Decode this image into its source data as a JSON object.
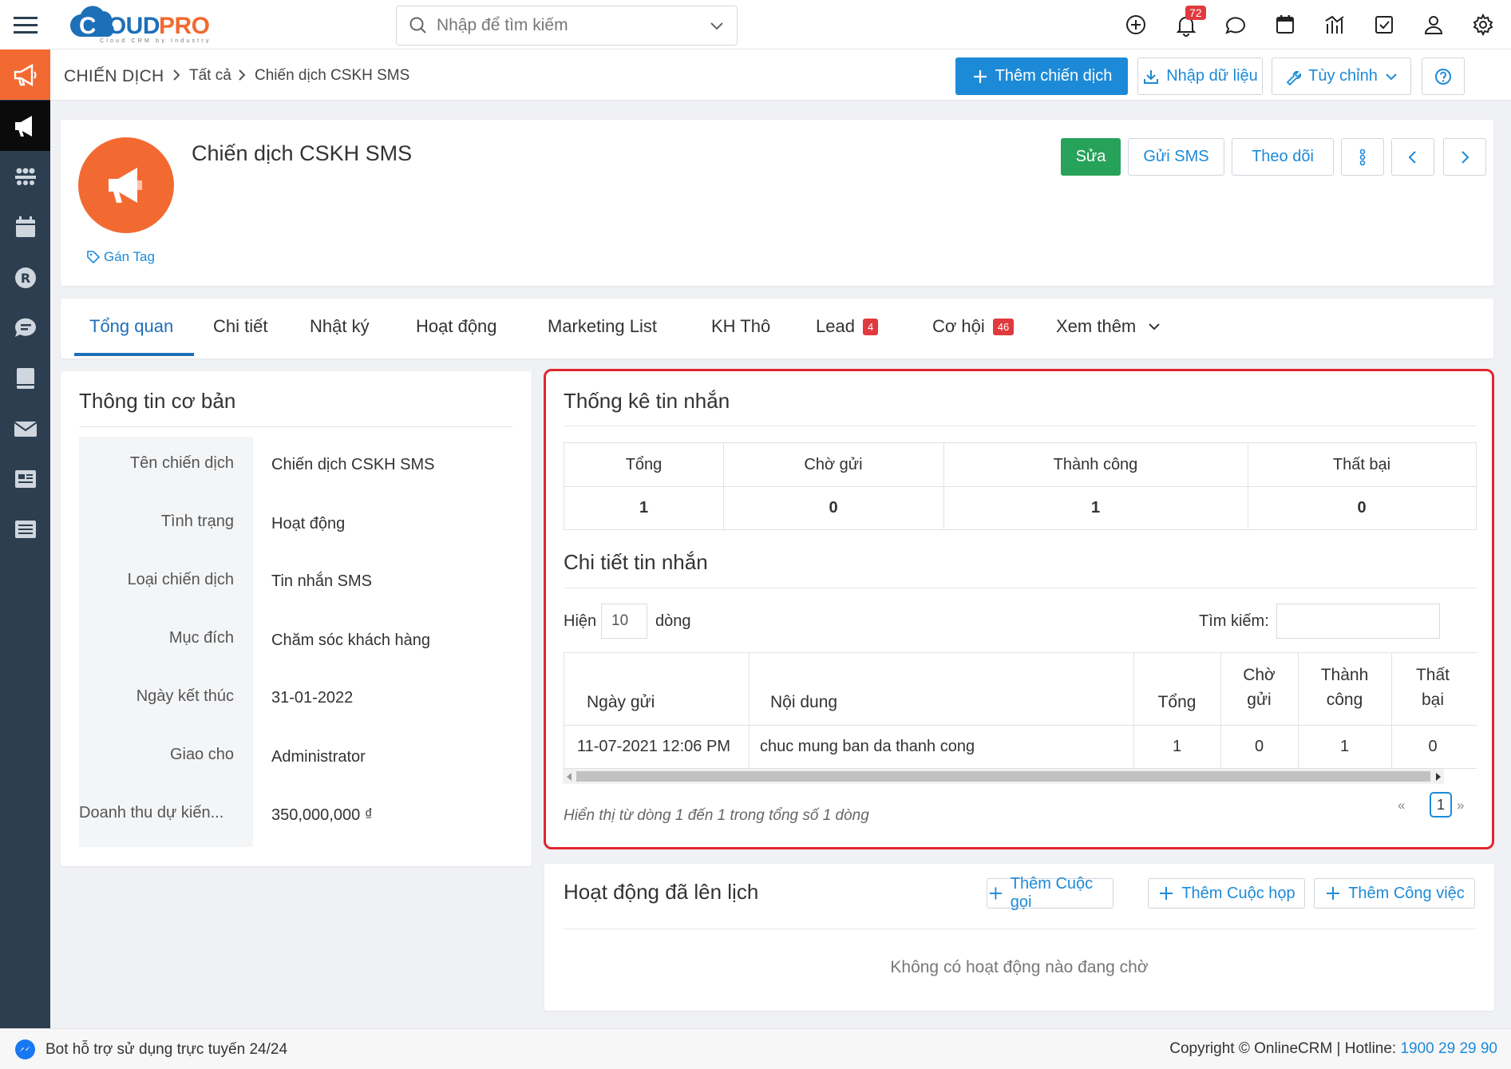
{
  "brand": {
    "logo_text": "CLOUDPRO",
    "tagline": "Cloud CRM by Industry"
  },
  "search": {
    "placeholder": "Nhập để tìm kiếm"
  },
  "topbar": {
    "notification_count": "72"
  },
  "breadcrumb": {
    "module": "CHIẾN DỊCH",
    "level1": "Tất cả",
    "level2": "Chiến dịch CSKH SMS"
  },
  "actions": {
    "add": "Thêm chiến dịch",
    "import": "Nhập dữ liệu",
    "customize": "Tùy chỉnh"
  },
  "record": {
    "title": "Chiến dịch CSKH SMS",
    "tag_label": "Gán Tag",
    "buttons": {
      "edit": "Sửa",
      "send_sms": "Gửi SMS",
      "follow": "Theo dõi"
    }
  },
  "tabs": [
    {
      "label": "Tổng quan"
    },
    {
      "label": "Chi tiết"
    },
    {
      "label": "Nhật ký"
    },
    {
      "label": "Hoạt động"
    },
    {
      "label": "Marketing List"
    },
    {
      "label": "KH Thô"
    },
    {
      "label": "Lead",
      "badge": "4"
    },
    {
      "label": "Cơ hội",
      "badge": "46"
    },
    {
      "label": "Xem thêm"
    }
  ],
  "basic_info": {
    "title": "Thông tin cơ bản",
    "fields": [
      {
        "label": "Tên chiến dịch",
        "value": "Chiến dịch CSKH SMS"
      },
      {
        "label": "Tình trạng",
        "value": "Hoạt động"
      },
      {
        "label": "Loại chiến dịch",
        "value": "Tin nhắn SMS"
      },
      {
        "label": "Mục đích",
        "value": "Chăm sóc khách hàng"
      },
      {
        "label": "Ngày kết thúc",
        "value": "31-01-2022"
      },
      {
        "label": "Giao cho",
        "value": "Administrator"
      },
      {
        "label": "Doanh thu dự kiến...",
        "value": "350,000,000 ₫"
      }
    ]
  },
  "sms_stats": {
    "title": "Thống kê tin nhắn",
    "headers": [
      "Tổng",
      "Chờ gửi",
      "Thành công",
      "Thất bại"
    ],
    "values": [
      "1",
      "0",
      "1",
      "0"
    ]
  },
  "sms_detail": {
    "title": "Chi tiết tin nhắn",
    "show_label": "Hiện",
    "page_length": "10",
    "rows_label": "dòng",
    "search_label": "Tìm kiếm:",
    "headers": {
      "date": "Ngày gửi",
      "content": "Nội dung",
      "total": "Tổng",
      "pending_1": "Chờ",
      "pending_2": "gửi",
      "success_1": "Thành",
      "success_2": "công",
      "fail_1": "Thất",
      "fail_2": "bại"
    },
    "rows": [
      {
        "date": "11-07-2021 12:06 PM",
        "content": "chuc mung ban da thanh cong",
        "total": "1",
        "pending": "0",
        "success": "1",
        "fail": "0"
      }
    ],
    "info": "Hiển thị từ dòng 1 đến 1 trong tổng số 1 dòng",
    "prev": "«",
    "page": "1",
    "next": "»"
  },
  "scheduled": {
    "title": "Hoạt động đã lên lịch",
    "add_call": "Thêm Cuộc gọi",
    "add_meeting": "Thêm Cuộc họp",
    "add_task": "Thêm Công việc",
    "empty": "Không có hoạt động nào đang chờ"
  },
  "footer": {
    "bot": "Bot hỗ trợ sử dụng trực tuyến 24/24",
    "copyright": "Copyright © OnlineCRM | Hotline: ",
    "hotline": "1900 29 29 90"
  },
  "colors": {
    "accent": "#1d8ad7",
    "brand_orange": "#f26a32",
    "success": "#27a25b",
    "badge": "#e0393e",
    "highlight": "#e0262e",
    "sidebar": "#2c3e50"
  }
}
